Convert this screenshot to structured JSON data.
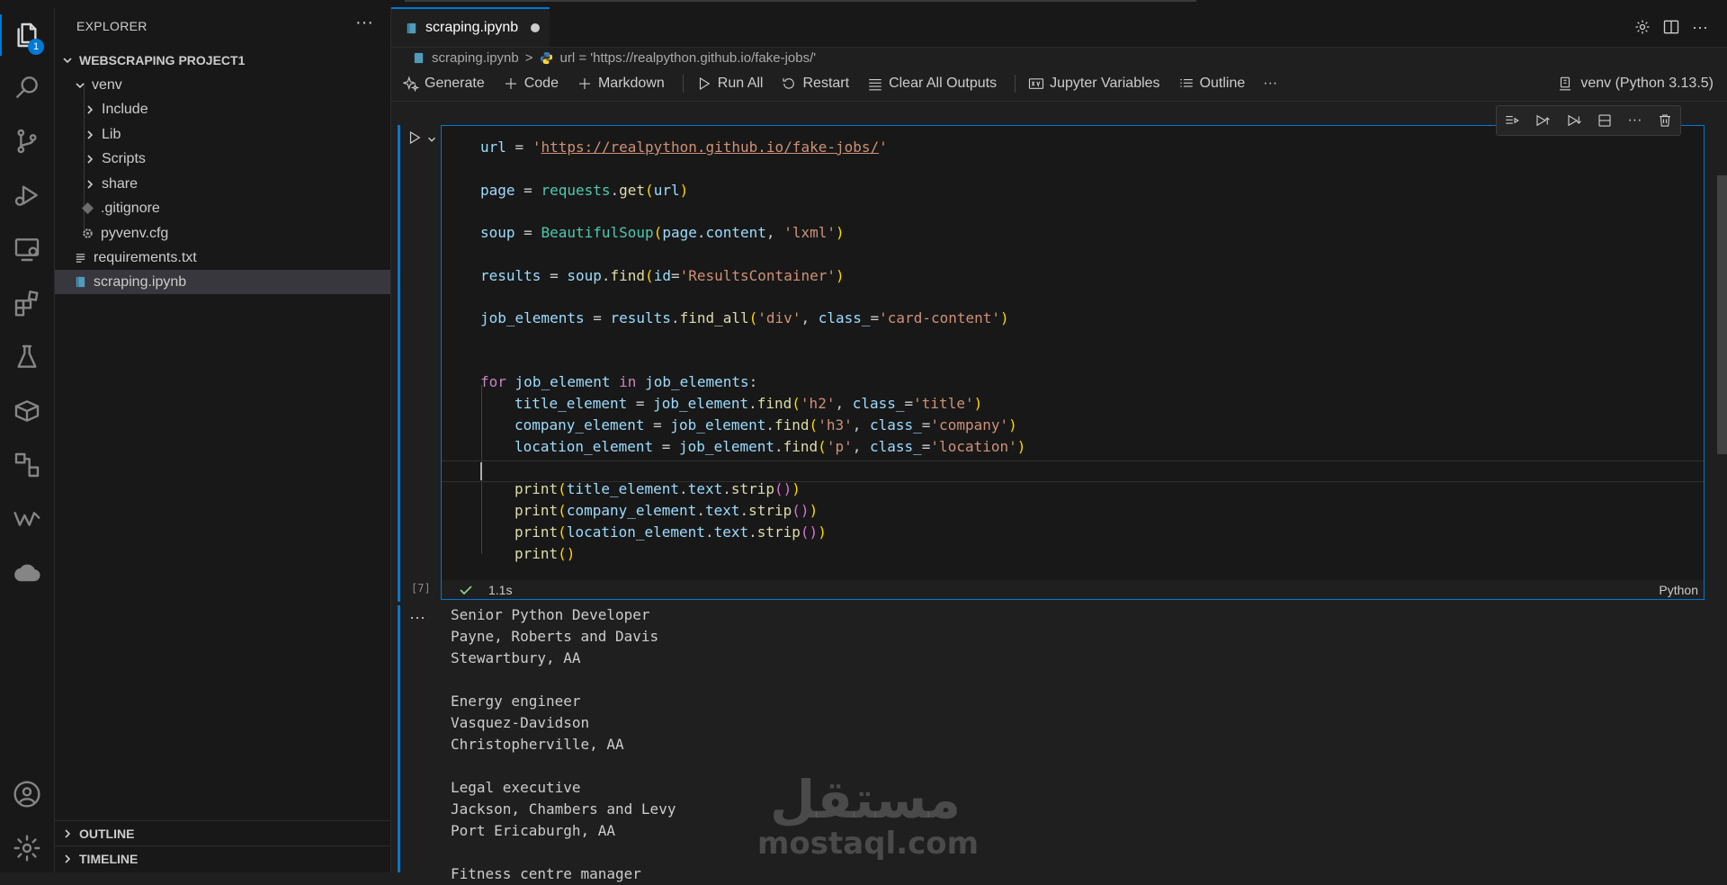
{
  "sidebar": {
    "title": "EXPLORER",
    "more": "···",
    "project": "WEBSCRAPING PROJECT1",
    "tree": [
      {
        "label": "venv"
      },
      {
        "label": "Include"
      },
      {
        "label": "Lib"
      },
      {
        "label": "Scripts"
      },
      {
        "label": "share"
      },
      {
        "label": ".gitignore"
      },
      {
        "label": "pyvenv.cfg"
      },
      {
        "label": "requirements.txt"
      },
      {
        "label": "scraping.ipynb"
      }
    ],
    "outline": "OUTLINE",
    "timeline": "TIMELINE"
  },
  "activity": {
    "explorer_badge": "1"
  },
  "tab": {
    "label": "scraping.ipynb"
  },
  "breadcrumb": {
    "file": "scraping.ipynb",
    "separator": ">",
    "symbol": "url = 'https://realpython.github.io/fake-jobs/'"
  },
  "toolbar": {
    "generate": "Generate",
    "code": "Code",
    "markdown": "Markdown",
    "run_all": "Run All",
    "restart": "Restart",
    "clear_outputs": "Clear All Outputs",
    "variables": "Jupyter Variables",
    "outline": "Outline",
    "more": "···",
    "kernel": "venv (Python 3.13.5)"
  },
  "cell": {
    "exec_count": "[7]",
    "time": "1.1s",
    "language": "Python",
    "lines": [
      "url = 'https://realpython.github.io/fake-jobs/'",
      "page = requests.get(url)",
      "soup = BeautifulSoup(page.content, 'lxml')",
      "results = soup.find(id='ResultsContainer')",
      "job_elements = results.find_all('div', class_='card-content')",
      "for job_element in job_elements:",
      "title_element = job_element.find('h2', class_='title')",
      "company_element = job_element.find('h3', class_='company')",
      "location_element = job_element.find('p', class_='location')",
      "print(title_element.text.strip())",
      "print(company_element.text.strip())",
      "print(location_element.text.strip())",
      "print()"
    ]
  },
  "output": {
    "dots": "···",
    "lines": [
      "Senior Python Developer",
      "Payne, Roberts and Davis",
      "Stewartbury, AA",
      "",
      "Energy engineer",
      "Vasquez-Davidson",
      "Christopherville, AA",
      "",
      "Legal executive",
      "Jackson, Chambers and Levy",
      "Port Ericaburgh, AA",
      "",
      "Fitness centre manager"
    ]
  },
  "watermark": {
    "arabic": "مستقل",
    "latin": "mostaql.com"
  },
  "colors": {
    "accent": "#0078d4",
    "background": "#1f1f1f",
    "sidebar": "#181818",
    "string": "#ce9178",
    "keyword": "#c586c0",
    "variable": "#9cdcfe",
    "function": "#dcdcaa",
    "class": "#4ec9b0"
  }
}
